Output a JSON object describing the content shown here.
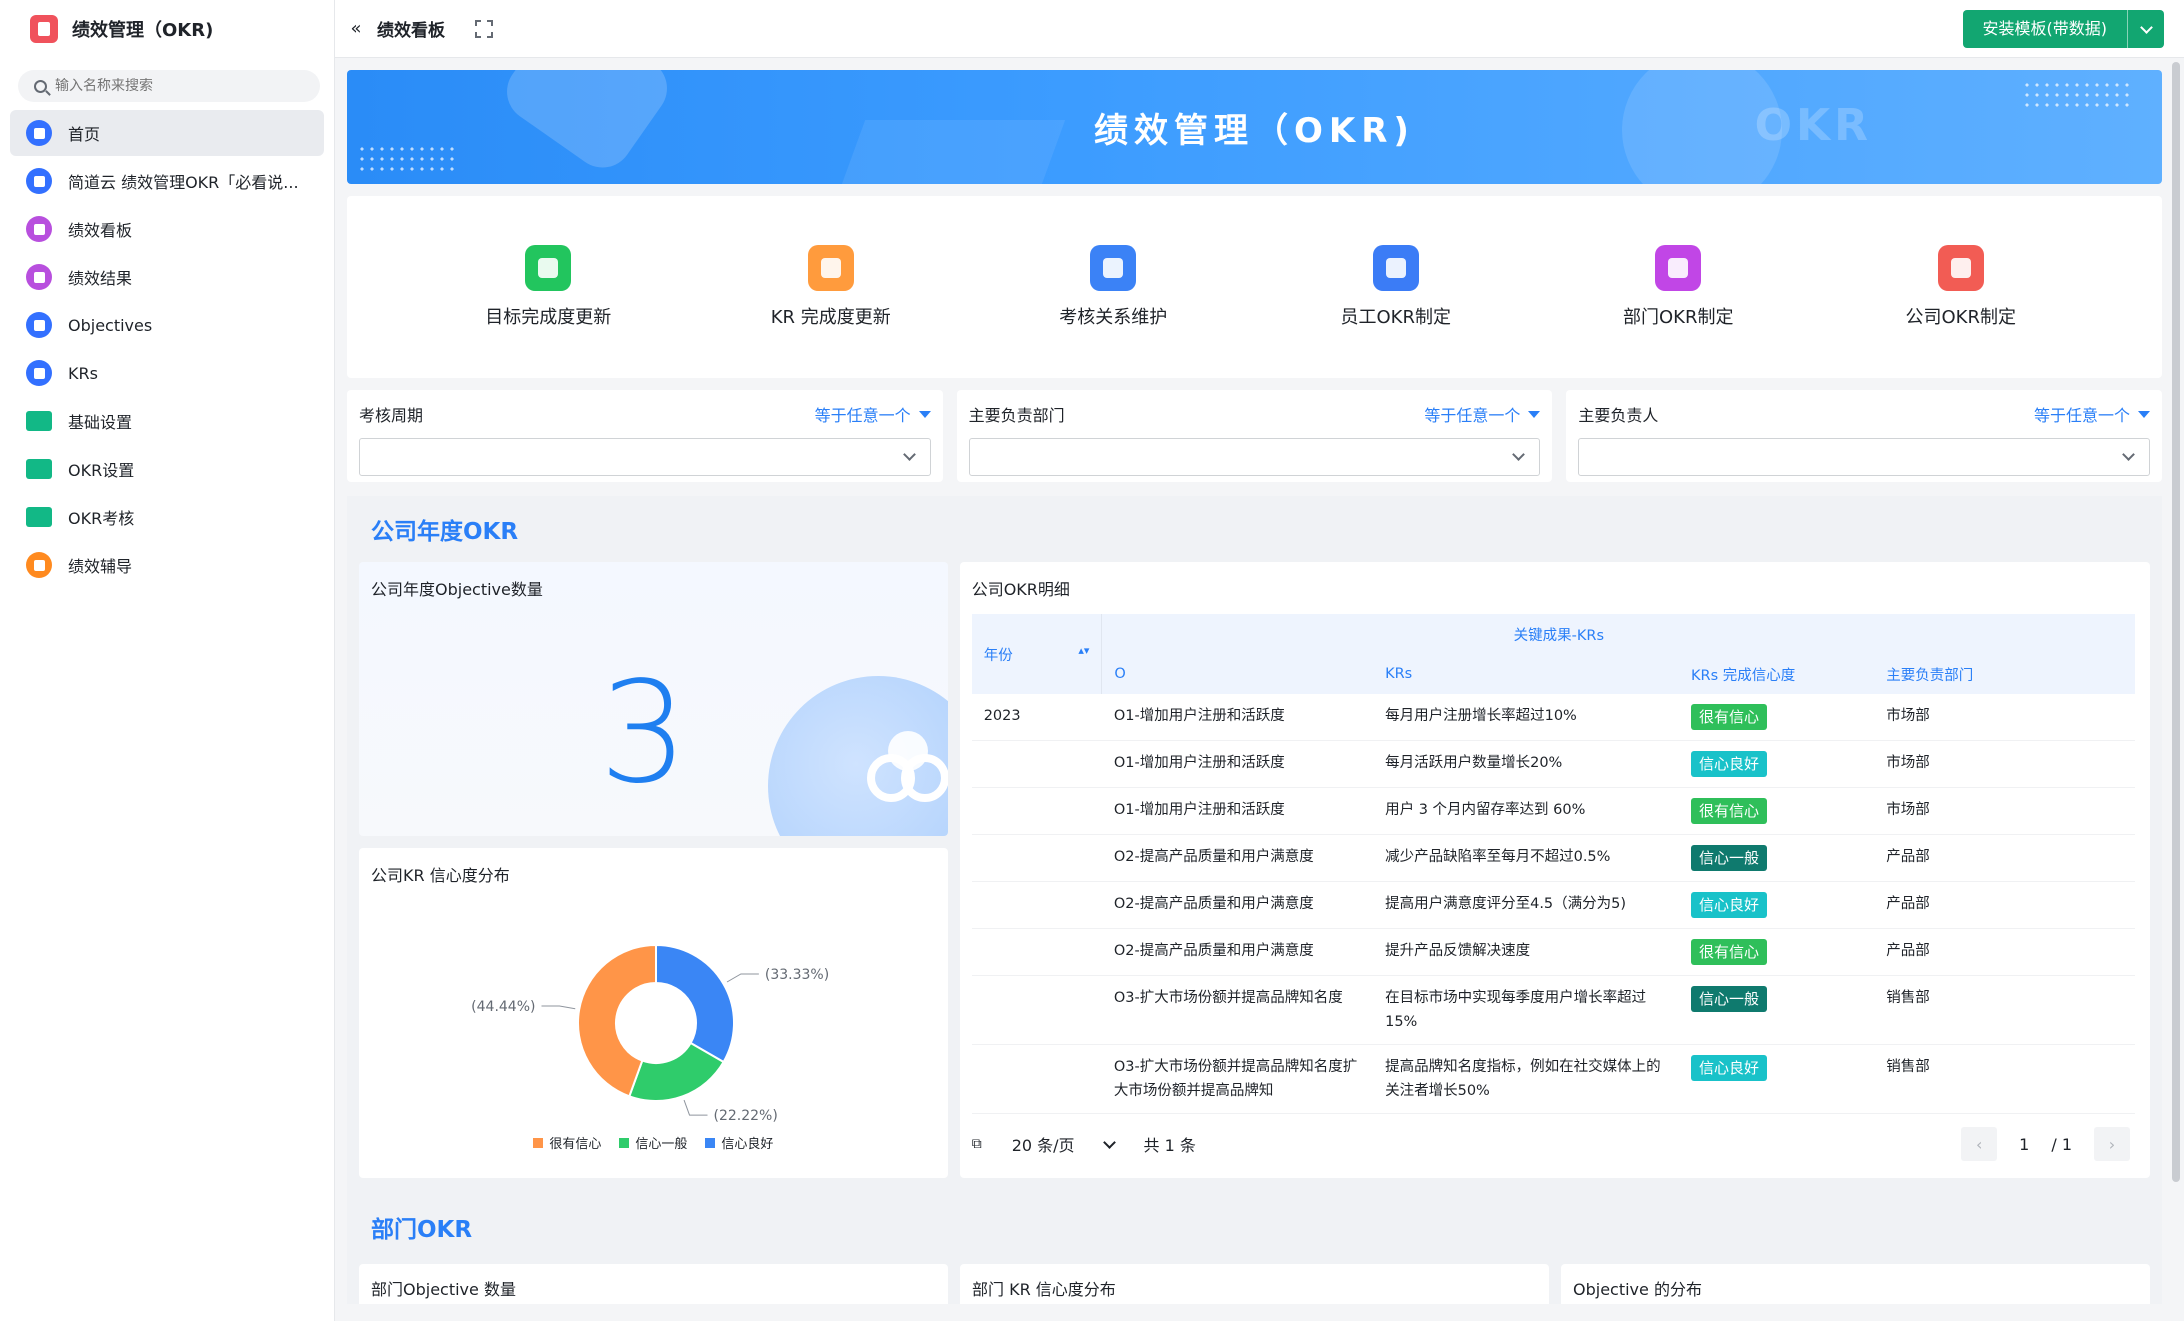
{
  "app": {
    "title": "绩效管理（OKR)"
  },
  "search": {
    "placeholder": "输入名称来搜索"
  },
  "sidebar": {
    "items": [
      {
        "label": "首页",
        "icon": "home-icon",
        "color": "#3370ff"
      },
      {
        "label": "简道云 绩效管理OKR「必看说...",
        "icon": "document-icon",
        "color": "#3370ff"
      },
      {
        "label": "绩效看板",
        "icon": "dashboard-icon",
        "color": "#b84fde"
      },
      {
        "label": "绩效结果",
        "icon": "dashboard-icon",
        "color": "#b84fde"
      },
      {
        "label": "Objectives",
        "icon": "target-icon",
        "color": "#3370ff"
      },
      {
        "label": "KRs",
        "icon": "bookmark-icon",
        "color": "#3370ff"
      },
      {
        "label": "基础设置",
        "icon": "folder-icon",
        "color": "#12b886"
      },
      {
        "label": "OKR设置",
        "icon": "folder-icon",
        "color": "#12b886"
      },
      {
        "label": "OKR考核",
        "icon": "folder-icon",
        "color": "#12b886"
      },
      {
        "label": "绩效辅导",
        "icon": "chart-icon",
        "color": "#ff8a1f"
      }
    ]
  },
  "topbar": {
    "breadcrumb": "绩效看板",
    "install_label": "安装模板(带数据)"
  },
  "banner": {
    "title": "绩效管理（OKR)",
    "watermark": "OKR"
  },
  "shortcuts": [
    {
      "label": "目标完成度更新",
      "icon": "flag-icon",
      "color": "#22c55e"
    },
    {
      "label": "KR 完成度更新",
      "icon": "envelope-icon",
      "color": "#ff9b3d"
    },
    {
      "label": "考核关系维护",
      "icon": "download-icon",
      "color": "#3b82f6"
    },
    {
      "label": "员工OKR制定",
      "icon": "document-icon",
      "color": "#3b7cf6"
    },
    {
      "label": "部门OKR制定",
      "icon": "chart-circle-icon",
      "color": "#c146e6"
    },
    {
      "label": "公司OKR制定",
      "icon": "star-file-icon",
      "color": "#f25c54"
    }
  ],
  "filters": [
    {
      "label": "考核周期",
      "op": "等于任意一个"
    },
    {
      "label": "主要负责部门",
      "op": "等于任意一个"
    },
    {
      "label": "主要负责人",
      "op": "等于任意一个"
    }
  ],
  "company_section": {
    "title": "公司年度OKR",
    "count_card": {
      "title": "公司年度Objective数量",
      "value": "3"
    },
    "donut_card": {
      "title": "公司KR 信心度分布",
      "legend": [
        "很有信心",
        "信心一般",
        "信心良好"
      ]
    },
    "detail_card": {
      "title": "公司OKR明细",
      "group_header": "关键成果-KRs",
      "headers": {
        "year": "年份",
        "o": "O",
        "krs": "KRs",
        "confidence": "KRs 完成信心度",
        "dept": "主要负责部门"
      },
      "year": "2023",
      "rows": [
        {
          "o": "O1-增加用户注册和活跃度",
          "kr": "每月用户注册增长率超过10%",
          "conf": "很有信心",
          "dept": "市场部"
        },
        {
          "o": "O1-增加用户注册和活跃度",
          "kr": "每月活跃用户数量增长20%",
          "conf": "信心良好",
          "dept": "市场部"
        },
        {
          "o": "O1-增加用户注册和活跃度",
          "kr": "用户 3 个月内留存率达到 60%",
          "conf": "很有信心",
          "dept": "市场部"
        },
        {
          "o": "O2-提高产品质量和用户满意度",
          "kr": "减少产品缺陷率至每月不超过0.5%",
          "conf": "信心一般",
          "dept": "产品部"
        },
        {
          "o": "O2-提高产品质量和用户满意度",
          "kr": "提高用户满意度评分至4.5（满分为5)",
          "conf": "信心良好",
          "dept": "产品部"
        },
        {
          "o": "O2-提高产品质量和用户满意度",
          "kr": "提升产品反馈解决速度",
          "conf": "很有信心",
          "dept": "产品部"
        },
        {
          "o": "O3-扩大市场份额并提高品牌知名度",
          "kr": "在目标市场中实现每季度用户增长率超过15%",
          "conf": "信心一般",
          "dept": "销售部"
        },
        {
          "o": "O3-扩大市场份额并提高品牌知名度扩大市场份额并提高品牌知",
          "kr": "提高品牌知名度指标，例如在社交媒体上的关注者增长50%",
          "conf": "信心良好",
          "dept": "销售部"
        }
      ],
      "pager": {
        "page_size": "20 条/页",
        "total": "共 1 条",
        "page": "1",
        "pages": "/ 1"
      }
    }
  },
  "conf_colors": {
    "很有信心": "#2fbf5a",
    "信心良好": "#19c2c9",
    "信心一般": "#0f7a6e"
  },
  "dept_section": {
    "title": "部门OKR",
    "cards": [
      "部门Objective 数量",
      "部门 KR 信心度分布",
      "Objective 的分布"
    ]
  },
  "chart_data": {
    "type": "pie",
    "title": "公司KR 信心度分布",
    "series": [
      {
        "name": "很有信心",
        "value": 44.44,
        "label": "(44.44%)",
        "color": "#ff9548"
      },
      {
        "name": "信心一般",
        "value": 22.22,
        "label": "(22.22%)",
        "color": "#2fcc6b"
      },
      {
        "name": "信心良好",
        "value": 33.33,
        "label": "(33.33%)",
        "color": "#3a86f5"
      }
    ],
    "legend": "bottom"
  }
}
